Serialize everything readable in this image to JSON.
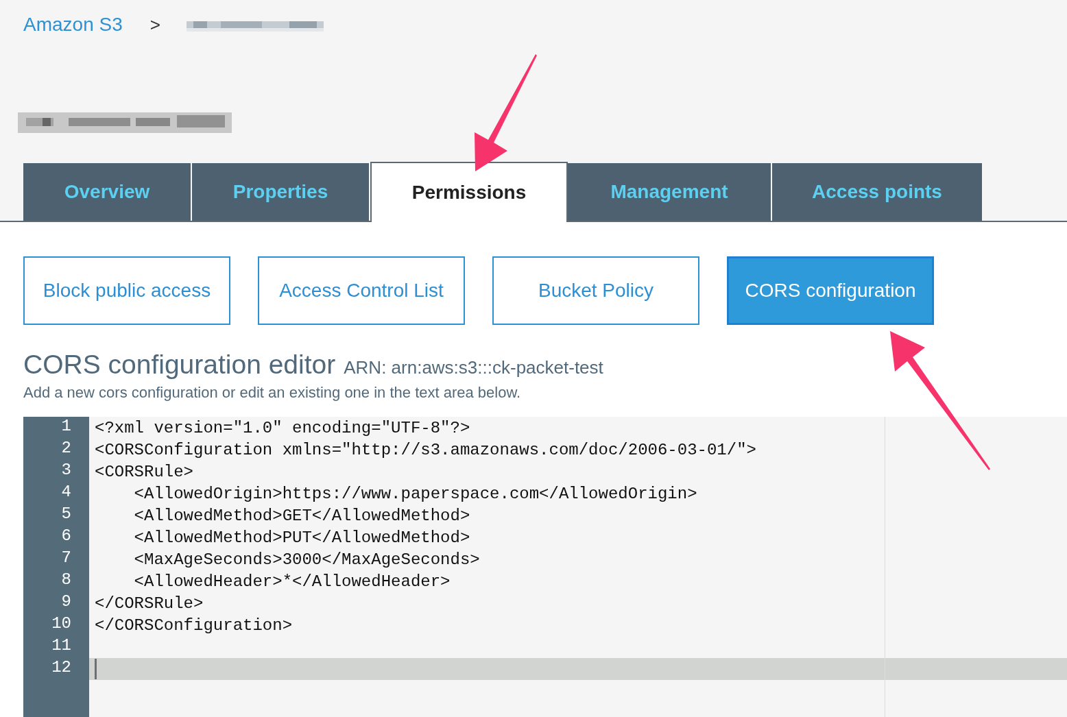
{
  "breadcrumb": {
    "root": "Amazon S3",
    "separator": ">"
  },
  "tabs": [
    {
      "label": "Overview",
      "selected": false
    },
    {
      "label": "Properties",
      "selected": false
    },
    {
      "label": "Permissions",
      "selected": true
    },
    {
      "label": "Management",
      "selected": false
    },
    {
      "label": "Access points",
      "selected": false
    }
  ],
  "sub_tabs": [
    {
      "label": "Block public access",
      "selected": false
    },
    {
      "label": "Access Control List",
      "selected": false
    },
    {
      "label": "Bucket Policy",
      "selected": false
    },
    {
      "label": "CORS configuration",
      "selected": true
    }
  ],
  "editor": {
    "title": "CORS configuration editor",
    "arn": "ARN: arn:aws:s3:::ck-packet-test",
    "description": "Add a new cors configuration or edit an existing one in the text area below.",
    "lines": [
      {
        "number": "1",
        "code": "<?xml version=\"1.0\" encoding=\"UTF-8\"?>",
        "active": false
      },
      {
        "number": "2",
        "code": "<CORSConfiguration xmlns=\"http://s3.amazonaws.com/doc/2006-03-01/\">",
        "active": false
      },
      {
        "number": "3",
        "code": "<CORSRule>",
        "active": false
      },
      {
        "number": "4",
        "code": "    <AllowedOrigin>https://www.paperspace.com</AllowedOrigin>",
        "active": false
      },
      {
        "number": "5",
        "code": "    <AllowedMethod>GET</AllowedMethod>",
        "active": false
      },
      {
        "number": "6",
        "code": "    <AllowedMethod>PUT</AllowedMethod>",
        "active": false
      },
      {
        "number": "7",
        "code": "    <MaxAgeSeconds>3000</MaxAgeSeconds>",
        "active": false
      },
      {
        "number": "8",
        "code": "    <AllowedHeader>*</AllowedHeader>",
        "active": false
      },
      {
        "number": "9",
        "code": "</CORSRule>",
        "active": false
      },
      {
        "number": "10",
        "code": "</CORSConfiguration>",
        "active": false
      },
      {
        "number": "11",
        "active": false
      },
      {
        "number": "12",
        "active": true
      }
    ]
  }
}
